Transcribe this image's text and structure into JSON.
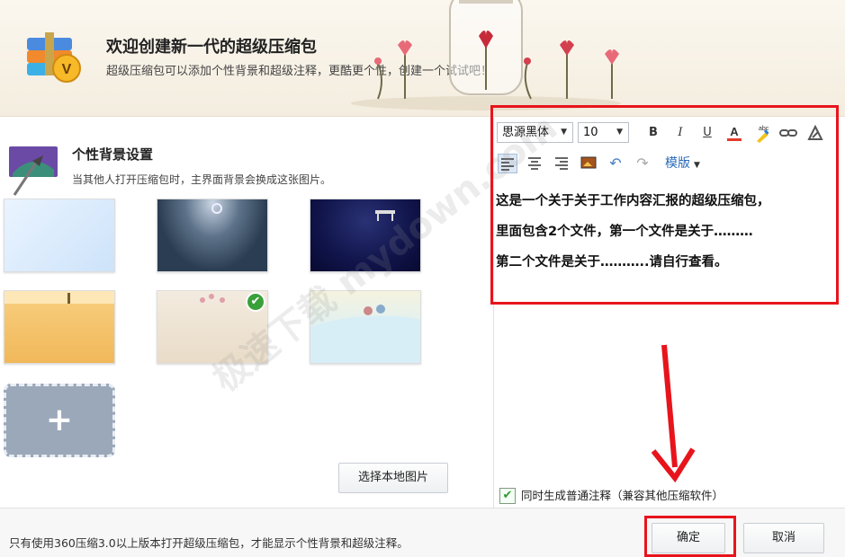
{
  "header": {
    "title": "欢迎创建新一代的超级压缩包",
    "subtitle": "超级压缩包可以添加个性背景和超级注释，更酷更个性，创建一个试试吧！"
  },
  "background": {
    "title": "个性背景设置",
    "description": "当其他人打开压缩包时，主界面背景会换成这张图片。",
    "selected_index": 4,
    "local_button": "选择本地图片"
  },
  "toolbar": {
    "font": "思源黑体",
    "size": "10",
    "template": "模版"
  },
  "editor": {
    "lines": [
      "这是一个关于关于工作内容汇报的超级压缩包，",
      "里面包含2个文件，第一个文件是关于………",
      "第二个文件是关于………..请自行查看。"
    ]
  },
  "options": {
    "normal_note": "同时生成普通注释（兼容其他压缩软件）",
    "normal_note_checked": true
  },
  "footer": {
    "notice": "只有使用360压缩3.0以上版本打开超级压缩包，才能显示个性背景和超级注释。",
    "ok": "确定",
    "cancel": "取消"
  },
  "watermark": "极速下载 mydown.com",
  "colors": {
    "annotation_red": "#e8141c",
    "check_green": "#39a03a",
    "link_blue": "#2a6ab8"
  }
}
